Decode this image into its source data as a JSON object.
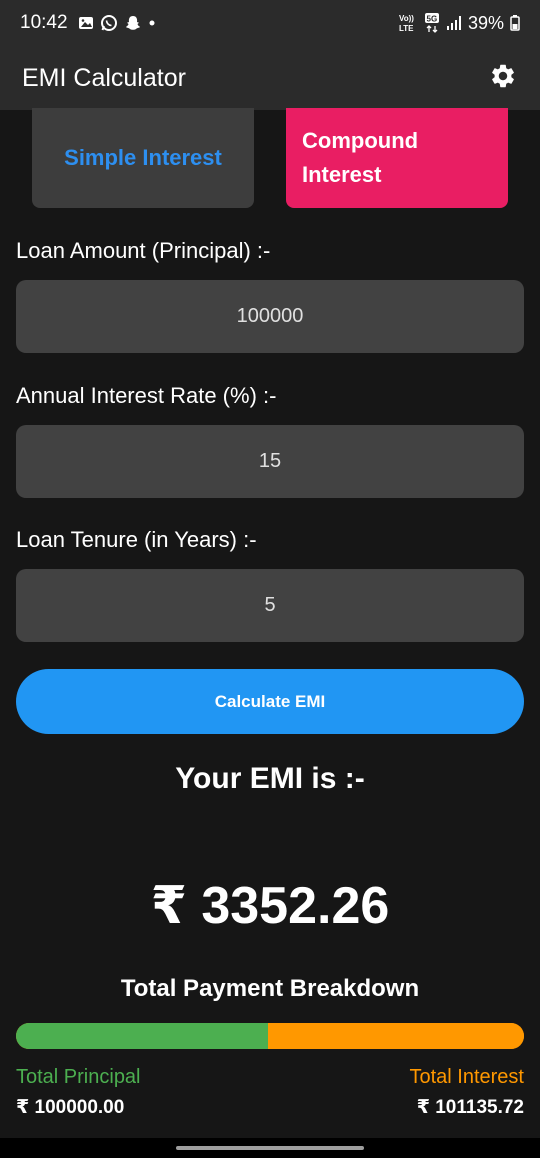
{
  "status_bar": {
    "time": "10:42",
    "battery": "39%",
    "left_icons": [
      "gallery-icon",
      "whatsapp-icon",
      "snapchat-icon",
      "dot-icon"
    ],
    "right_icons": [
      "volte-icon",
      "5g-icon",
      "signal-icon",
      "battery-icon"
    ]
  },
  "app_bar": {
    "title": "EMI Calculator",
    "settings_icon": "gear-icon"
  },
  "interest_types": {
    "simple": "Simple Interest",
    "compound": "Compound Interest",
    "selected": "compound"
  },
  "fields": {
    "principal": {
      "label": "Loan Amount (Principal) :-",
      "value": "100000"
    },
    "rate": {
      "label": "Annual Interest Rate (%) :-",
      "value": "15"
    },
    "tenure": {
      "label": "Loan Tenure (in Years) :-",
      "value": "5"
    }
  },
  "calculate_label": "Calculate EMI",
  "result": {
    "heading": "Your EMI is :-",
    "emi": "₹ 3352.26"
  },
  "breakdown": {
    "title": "Total Payment Breakdown",
    "principal_label": "Total Principal",
    "interest_label": "Total Interest",
    "principal_amount": "₹ 100000.00",
    "interest_amount": "₹ 101135.72",
    "principal_fraction": 0.497
  },
  "colors": {
    "accent": "#2196f3",
    "compound": "#e91e63",
    "principal": "#4caf50",
    "interest": "#ff9800"
  }
}
